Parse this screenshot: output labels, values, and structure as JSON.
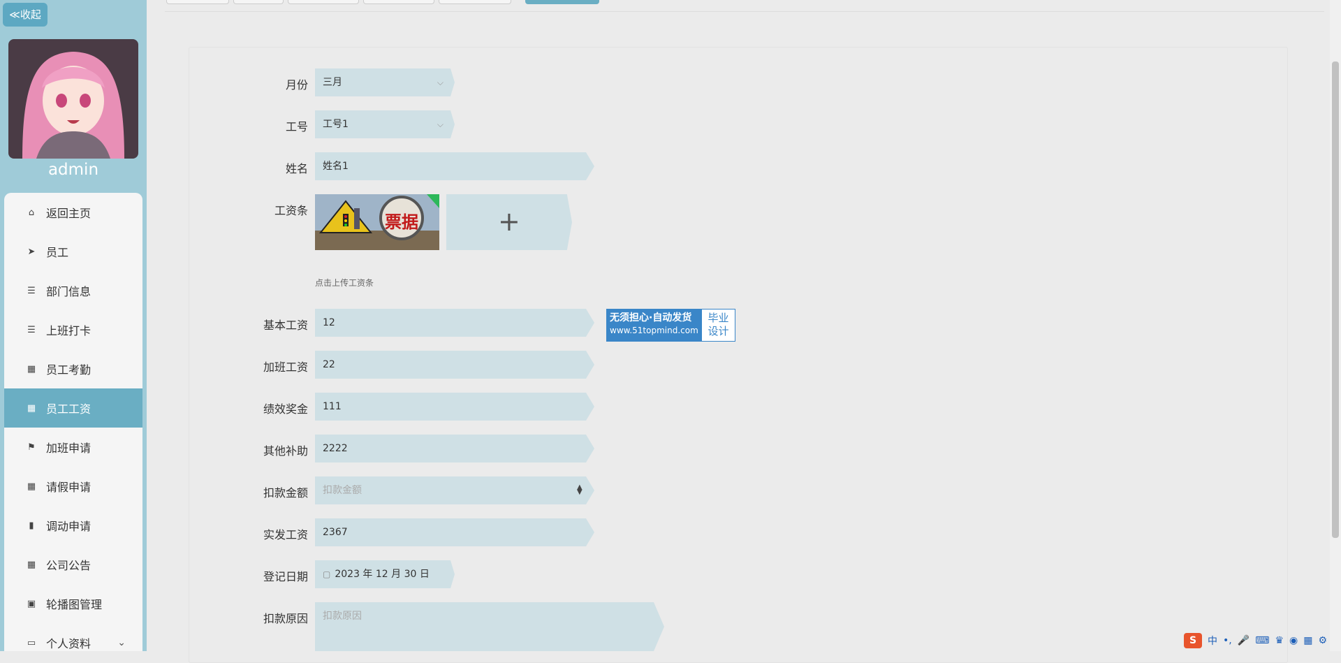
{
  "sidebar": {
    "collapse_label": "≪收起",
    "username": "admin",
    "menu": [
      {
        "label": "返回主页",
        "icon": "home-icon",
        "glyph": "⌂"
      },
      {
        "label": "员工",
        "icon": "paper-plane-icon",
        "glyph": "➤"
      },
      {
        "label": "部门信息",
        "icon": "list-icon",
        "glyph": "☰"
      },
      {
        "label": "上班打卡",
        "icon": "list-icon",
        "glyph": "☰"
      },
      {
        "label": "员工考勤",
        "icon": "grid-icon",
        "glyph": "▦"
      },
      {
        "label": "员工工资",
        "icon": "grid-icon",
        "glyph": "▦",
        "active": true
      },
      {
        "label": "加班申请",
        "icon": "flag-icon",
        "glyph": "⚑"
      },
      {
        "label": "请假申请",
        "icon": "grid-icon",
        "glyph": "▦"
      },
      {
        "label": "调动申请",
        "icon": "bar-chart-icon",
        "glyph": "▮"
      },
      {
        "label": "公司公告",
        "icon": "grid-icon",
        "glyph": "▦"
      },
      {
        "label": "轮播图管理",
        "icon": "film-icon",
        "glyph": "▣"
      },
      {
        "label": "个人资料",
        "icon": "profile-icon",
        "glyph": "▭",
        "chevron": "⌄"
      }
    ]
  },
  "form": {
    "month": {
      "label": "月份",
      "value": "三月"
    },
    "emp_no": {
      "label": "工号",
      "value": "工号1"
    },
    "name": {
      "label": "姓名",
      "value": "姓名1"
    },
    "payslip": {
      "label": "工资条",
      "hint": "点击上传工资条",
      "plus": "+",
      "image_text": "票据"
    },
    "base_salary": {
      "label": "基本工资",
      "value": "12"
    },
    "overtime_pay": {
      "label": "加班工资",
      "value": "22"
    },
    "bonus": {
      "label": "绩效奖金",
      "value": "111"
    },
    "allowance": {
      "label": "其他补助",
      "value": "2222"
    },
    "deduction": {
      "label": "扣款金额",
      "placeholder": "扣款金额"
    },
    "net_pay": {
      "label": "实发工资",
      "value": "2367"
    },
    "reg_date": {
      "label": "登记日期",
      "value": "2023 年 12 月 30 日"
    },
    "deduct_reason": {
      "label": "扣款原因",
      "placeholder": "扣款原因"
    }
  },
  "ad": {
    "line1": "无须担心·自动发货",
    "line2": "www.51topmind.com",
    "side1": "毕业",
    "side2": "设计"
  },
  "tray": {
    "logo": "S",
    "ime": "中"
  },
  "colors": {
    "sidebar": "#9fcbd8",
    "accent": "#6aaec3",
    "field": "#cfe0e5",
    "background": "#ebebeb"
  }
}
